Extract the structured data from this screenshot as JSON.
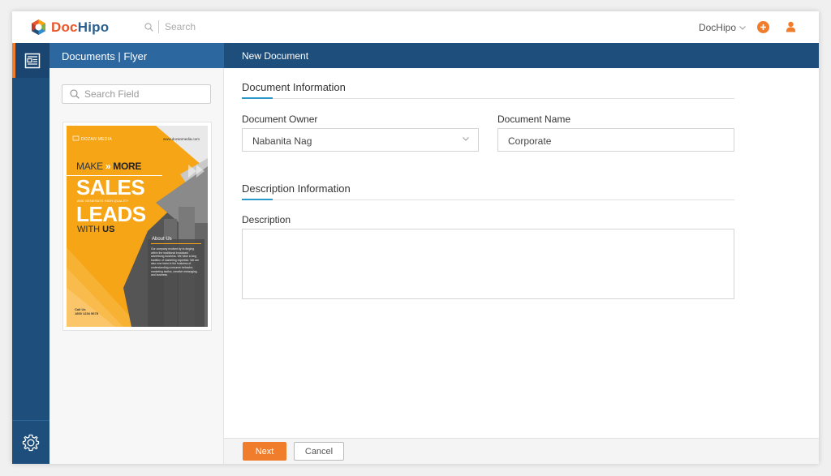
{
  "app": {
    "logo_doc": "Doc",
    "logo_hipo": "Hipo"
  },
  "topbar": {
    "search_placeholder": "Search",
    "account_label": "DocHipo"
  },
  "icons": {
    "search": "search-icon",
    "plus": "plus-icon",
    "user": "user-icon",
    "documents": "document-icon",
    "settings": "gear-icon",
    "chevron": "chevron-down-icon"
  },
  "colors": {
    "accent": "#ef7d2c",
    "nav": "#1e4e7b",
    "panel_header": "#2c67a0",
    "rule_accent": "#2a98c9"
  },
  "sidebar": {
    "title": "Documents | Flyer",
    "search_placeholder": "Search Field"
  },
  "flyer": {
    "brand": "DOZAN MEDIA",
    "website": "www.dozanmedia.com",
    "make": "MAKE",
    "more": "MORE",
    "sales": "SALES",
    "generate": "AND GENERATE HIGH QUALITY",
    "leads": "LEADS",
    "with": "WITH",
    "us": "US",
    "about": "About Us",
    "about_text": "Our company evolved by re-forging within the traditional broadcast advertising business. We have a long tradition of marketing expertise. We are also now been in the business of understanding consumer behavior, marketing tactics, creative messaging, and business.",
    "call_label": "Call Us",
    "phone": "1800 1234 5678"
  },
  "main": {
    "header": "New Document",
    "section1": "Document Information",
    "owner_label": "Document Owner",
    "owner_value": "Nabanita Nag",
    "name_label": "Document Name",
    "name_value": "Corporate",
    "section2": "Description Information",
    "desc_label": "Description"
  },
  "footer": {
    "next": "Next",
    "cancel": "Cancel"
  }
}
